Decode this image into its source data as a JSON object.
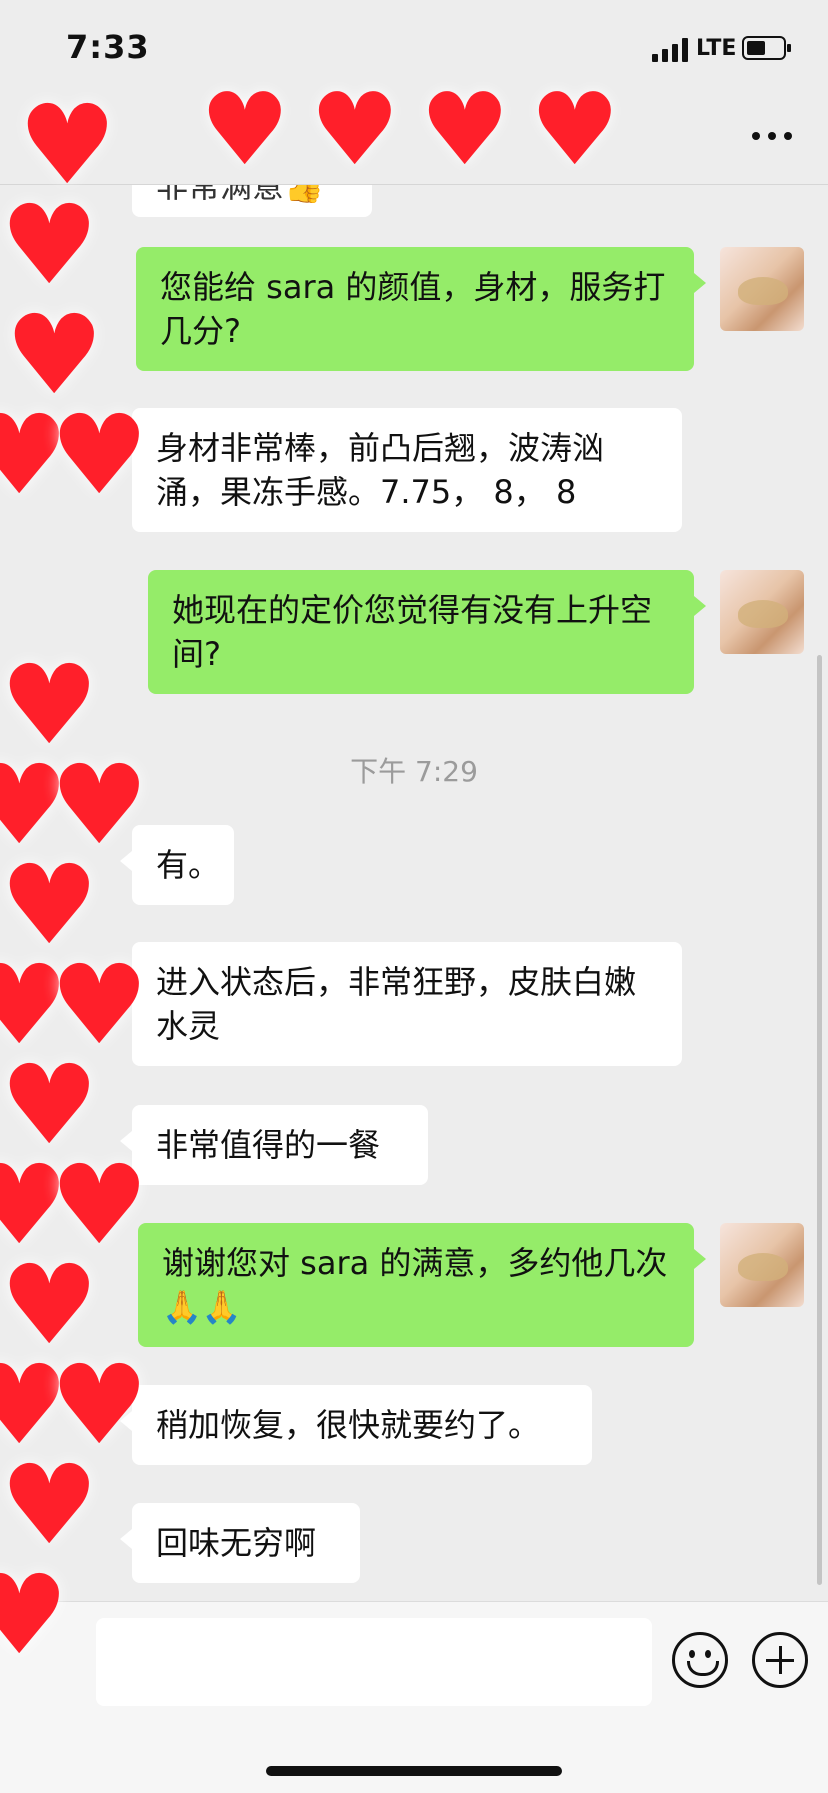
{
  "status_bar": {
    "time": "7:33",
    "network": "LTE"
  },
  "nav": {
    "title": ""
  },
  "messages": [
    {
      "side": "in",
      "text": "非常满意👍",
      "partial": true
    },
    {
      "side": "out",
      "text": "您能给 sara 的颜值，身材，服务打几分?"
    },
    {
      "side": "in",
      "text": "身材非常棒，前凸后翘，波涛汹涌，果冻手感。7.75， 8， 8"
    },
    {
      "side": "out",
      "text": "她现在的定价您觉得有没有上升空间?"
    },
    {
      "side": "time",
      "text": "下午 7:29"
    },
    {
      "side": "in",
      "text": "有。"
    },
    {
      "side": "in",
      "text": "进入状态后，非常狂野，皮肤白嫩水灵"
    },
    {
      "side": "in",
      "text": "非常值得的一餐"
    },
    {
      "side": "out",
      "text": "谢谢您对 sara 的满意，多约他几次🙏🙏"
    },
    {
      "side": "in",
      "text": "稍加恢复，很快就要约了。"
    },
    {
      "side": "in",
      "text": "回味无穷啊"
    }
  ],
  "input": {
    "placeholder": ""
  },
  "colors": {
    "outgoing_bubble": "#95ec69",
    "incoming_bubble": "#ffffff",
    "background": "#ededed",
    "redaction": "#ff1f2a"
  },
  "icons": {
    "back": "chevron-left-icon",
    "more": "more-dots-icon",
    "emoji": "emoji-icon",
    "add": "plus-circle-icon",
    "redaction": "heart-icon"
  }
}
